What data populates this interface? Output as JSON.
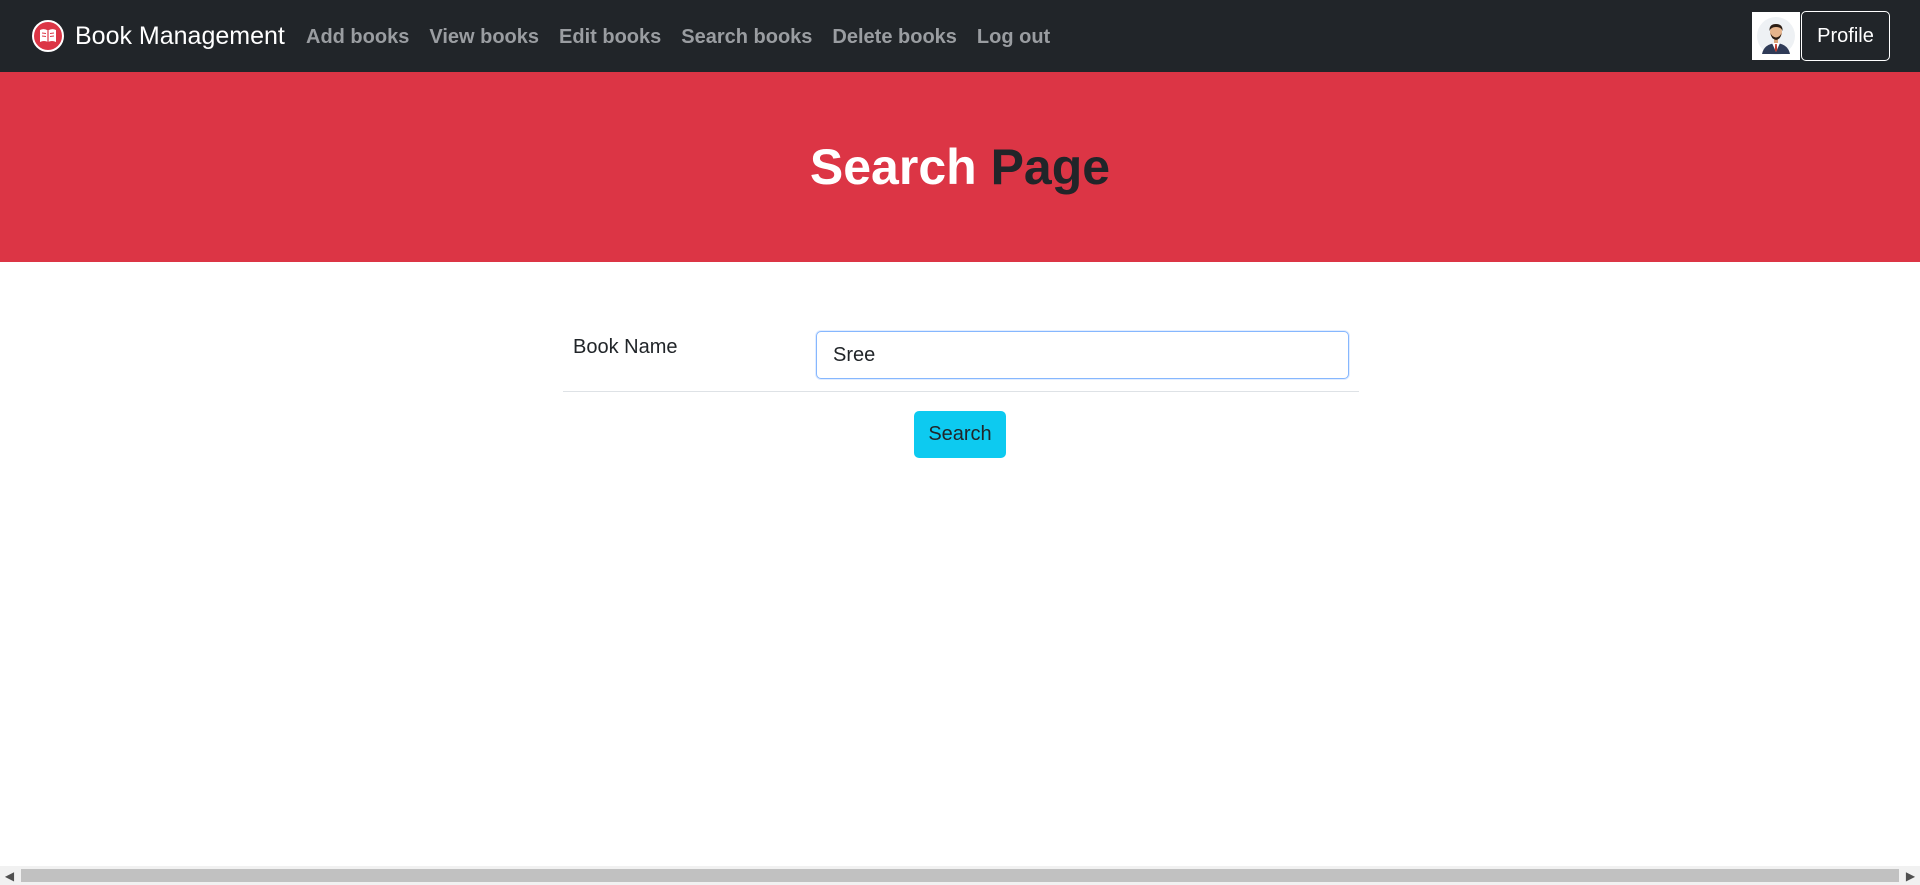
{
  "navbar": {
    "brand": "Book Management",
    "links": [
      {
        "label": "Add books"
      },
      {
        "label": "View books"
      },
      {
        "label": "Edit books"
      },
      {
        "label": "Search books"
      },
      {
        "label": "Delete books"
      },
      {
        "label": "Log out"
      }
    ],
    "profile_label": "Profile"
  },
  "hero": {
    "title_word1": "Search",
    "title_word2": "Page"
  },
  "form": {
    "label": "Book Name",
    "value": "Sree",
    "button_label": "Search"
  },
  "colors": {
    "navbar": "#212529",
    "hero": "#dc3545",
    "accent_button": "#0dcaf0",
    "nav_link": "#9a9da1"
  },
  "icons": {
    "brand": "book-icon",
    "avatar": "user-avatar-icon"
  }
}
